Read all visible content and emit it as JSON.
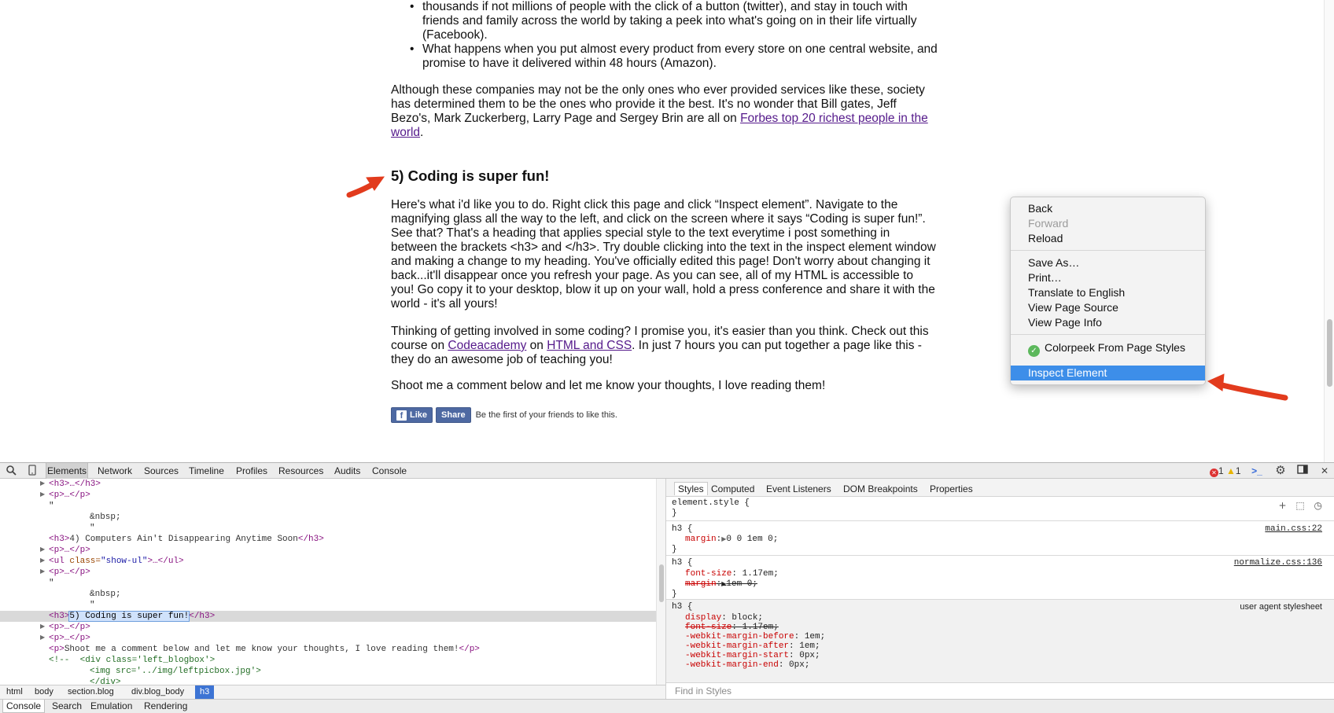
{
  "article": {
    "bullet_1": "thousands if not millions of people with the click of a button (twitter), and stay in touch with friends and family across the world by taking a peek into what's going on in their life virtually (Facebook).",
    "bullet_2": "What happens when you put almost every product from every store on one central website, and promise to have it delivered within 48 hours (Amazon).",
    "para_1_text": "Although these companies may not be the only ones who ever provided services like these, society has determined them to be the ones who provide it the best. It's no wonder that Bill gates, Jeff Bezo's, Mark Zuckerberg, Larry Page and Sergey Brin are all on ",
    "para_1_link": "Forbes top 20 richest people in the world",
    "para_1_end": ".",
    "heading": "5) Coding is super fun!",
    "para_2": "Here's what i'd like you to do. Right click this page and click “Inspect element”. Navigate to the magnifying glass all the way to the left, and click on the screen where it says “Coding is super fun!”. See that? That's a heading that applies special style to the text everytime i post something in between the brackets <h3> and </h3>. Try double clicking into the text in the inspect element window and making a change to my heading. You've officially edited this page! Don't worry about changing it back...it'll disappear once you refresh your page. As you can see, all of my HTML is accessible to you! Go copy it to your desktop, blow it up on your wall, hold a press conference and share it with the world - it's all yours!",
    "para_3_a": "Thinking of getting involved in some coding? I promise you, it's easier than you think. Check out this course on ",
    "para_3_link_1": "Codeacademy",
    "para_3_b": " on ",
    "para_3_link_2": "HTML and CSS",
    "para_3_c": ". In just 7 hours you can put together a page like this - they do an awesome job of teaching you!",
    "para_4": "Shoot me a comment below and let me know your thoughts, I love reading them!",
    "fb_like": "Like",
    "fb_share": "Share",
    "fb_social_text": "Be the first of your friends to like this."
  },
  "context_menu": {
    "items": [
      {
        "label": "Back",
        "disabled": false
      },
      {
        "label": "Forward",
        "disabled": true
      },
      {
        "label": "Reload",
        "disabled": false
      },
      {
        "label": "Save As…",
        "disabled": false
      },
      {
        "label": "Print…",
        "disabled": false
      },
      {
        "label": "Translate to English",
        "disabled": false
      },
      {
        "label": "View Page Source",
        "disabled": false
      },
      {
        "label": "View Page Info",
        "disabled": false
      },
      {
        "label": "Colorpeek From Page Styles",
        "disabled": false,
        "icon": "colorpeek-icon"
      },
      {
        "label": "Inspect Element",
        "disabled": false,
        "selected": true
      }
    ]
  },
  "devtools": {
    "tabs": [
      "Elements",
      "Network",
      "Sources",
      "Timeline",
      "Profiles",
      "Resources",
      "Audits",
      "Console"
    ],
    "active_tab": "Elements",
    "error_count": "1",
    "warning_count": "1",
    "dom": {
      "line_h3_collapsed": "<h3>…</h3>",
      "line_p_1": "<p>…</p>",
      "quote_1": "\"",
      "nbsp_1": "&nbsp;",
      "quote_2": "\"",
      "h3_open_4": "<h3>",
      "h3_text_4": "4) Computers Ain't Disappearing Anytime Soon",
      "h3_close_4": "</h3>",
      "line_p_2": "<p>…</p>",
      "ul_open": "<ul ",
      "ul_attr": "class=",
      "ul_val": "\"show-ul\"",
      "ul_rest": ">…</ul>",
      "line_p_3": "<p>…</p>",
      "quote_3": "\"",
      "nbsp_2": "&nbsp;",
      "quote_4": "\"",
      "sel_open": "<h3>",
      "sel_text": "5) Coding is super fun!",
      "sel_close": "</h3>",
      "line_p_4": "<p>…</p>",
      "line_p_5": "<p>…</p>",
      "p_open": "<p>",
      "p_text": "Shoot me a comment below and let me know your thoughts, I love reading them!",
      "p_close": "</p>",
      "comment_1": "<!--  <div class='left_blogbox'>",
      "comment_2": "<img src='../img/leftpicbox.jpg'>",
      "comment_3": "</div>"
    },
    "breadcrumbs": [
      "html",
      "body",
      "section.blog",
      "div.blog_body",
      "h3"
    ],
    "styles_tabs": [
      "Styles",
      "Computed",
      "Event Listeners",
      "DOM Breakpoints",
      "Properties"
    ],
    "rules": {
      "element_style": "element.style {",
      "close": "}",
      "h3_selector": "h3 {",
      "main_prop": "margin",
      "main_val": "0 0 1em 0;",
      "main_src": "main.css:22",
      "norm_prop_1": "font-size",
      "norm_val_1": "1.17em;",
      "norm_prop_2": "margin",
      "norm_val_2": "1em 0;",
      "norm_src": "normalize.css:136",
      "ua_src": "user agent stylesheet",
      "ua_prop_1": "display",
      "ua_val_1": "block;",
      "ua_prop_2": "font-size",
      "ua_val_2": "1.17em;",
      "ua_prop_3": "-webkit-margin-before",
      "ua_val_3": "1em;",
      "ua_prop_4": "-webkit-margin-after",
      "ua_val_4": "1em;",
      "ua_prop_5": "-webkit-margin-start",
      "ua_val_5": "0px;",
      "ua_prop_6": "-webkit-margin-end",
      "ua_val_6": "0px;"
    },
    "find_placeholder": "Find in Styles",
    "drawer_tabs": [
      "Console",
      "Search",
      "Emulation",
      "Rendering"
    ]
  },
  "colors": {
    "link": "#551a8b",
    "selection_blue": "#3d8ee9",
    "arrow_red": "#e23b1d",
    "css_property": "#c80000",
    "tag_purple": "#881280"
  }
}
